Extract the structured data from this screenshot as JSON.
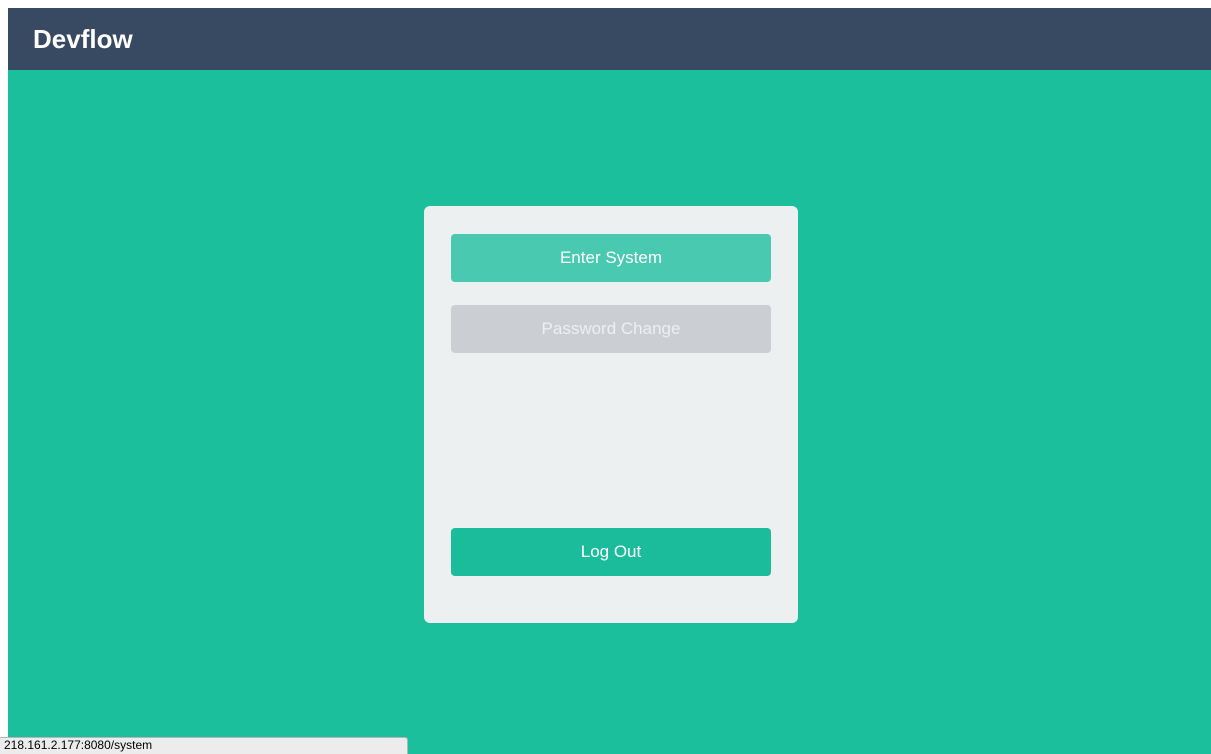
{
  "app": {
    "brand": "Devflow"
  },
  "panel": {
    "enter_system_label": "Enter System",
    "password_change_label": "Password Change",
    "log_out_label": "Log Out"
  },
  "status_bar": {
    "url": "218.161.2.177:8080/system"
  },
  "colors": {
    "background": "#1cbf9b",
    "header": "#374a62",
    "panel": "#ecf0f1",
    "enter_button": "#48c9b0",
    "password_button_disabled": "#cbcfd3",
    "logout_button": "#1abc9c"
  }
}
